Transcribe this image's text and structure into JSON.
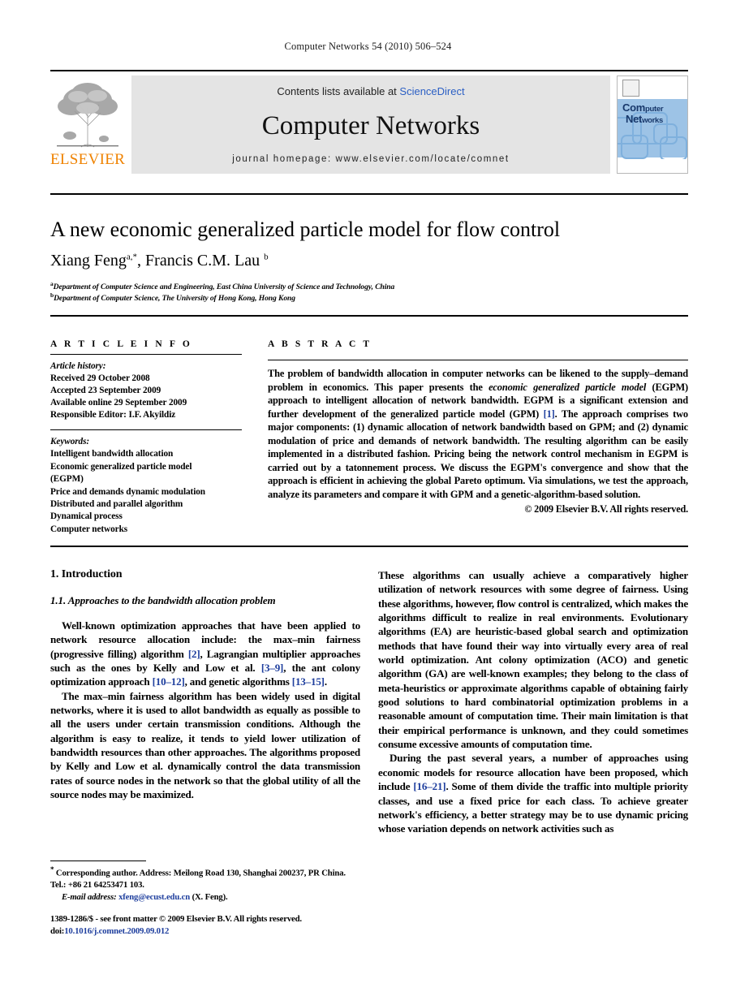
{
  "running_head": "Computer Networks 54 (2010) 506–524",
  "banner": {
    "contents_prefix": "Contents lists available at ",
    "contents_link": "ScienceDirect",
    "journal_title": "Computer Networks",
    "homepage": "journal homepage: www.elsevier.com/locate/comnet",
    "publisher_wordmark": "ELSEVIER",
    "cover": {
      "line1_strong": "Com",
      "line1_rest": "puter",
      "line2_strong": "Net",
      "line2_rest": "works"
    }
  },
  "article": {
    "title": "A new economic generalized particle model for flow control",
    "authors": "Xiang Feng",
    "author_sup_a": "a,*",
    "authors_second": ", Francis C.M. Lau ",
    "author_sup_b": "b",
    "affiliation_a_sup": "a",
    "affiliation_a": "Department of Computer Science and Engineering, East China University of Science and Technology, China",
    "affiliation_b_sup": "b",
    "affiliation_b": "Department of Computer Science, The University of Hong Kong, Hong Kong"
  },
  "info": {
    "heading": "A R T I C L E   I N F O",
    "history_label": "Article history:",
    "history": [
      "Received 29 October 2008",
      "Accepted 23 September 2009",
      "Available online 29 September 2009",
      "Responsible Editor: I.F. Akyildiz"
    ],
    "keywords_label": "Keywords:",
    "keywords": [
      "Intelligent bandwidth allocation",
      "Economic generalized particle model",
      "(EGPM)",
      "Price and demands dynamic modulation",
      "Distributed and parallel algorithm",
      "Dynamical process",
      "Computer networks"
    ]
  },
  "abstract": {
    "heading": "A B S T R A C T",
    "part1": "The problem of bandwidth allocation in computer networks can be likened to the supply–demand problem in economics. This paper presents the ",
    "italic1": "economic generalized particle model",
    "part2": " (EGPM) approach to intelligent allocation of network bandwidth. EGPM is a significant extension and further development of the generalized particle model (GPM) ",
    "cite1": "[1]",
    "part3": ". The approach comprises two major components: (1) dynamic allocation of network bandwidth based on GPM; and (2) dynamic modulation of price and demands of network bandwidth. The resulting algorithm can be easily implemented in a distributed fashion. Pricing being the network control mechanism in EGPM is carried out by a tatonnement process. We discuss the EGPM's convergence and show that the approach is efficient in achieving the global Pareto optimum. Via simulations, we test the approach, analyze its parameters and compare it with GPM and a genetic-algorithm-based solution.",
    "copyright": "© 2009 Elsevier B.V. All rights reserved."
  },
  "body": {
    "section_number_title": "1. Introduction",
    "subsection_number_title": "1.1. Approaches to the bandwidth allocation problem",
    "p1_a": "Well-known optimization approaches that have been applied to network resource allocation include: the max–min fairness (progressive filling) algorithm ",
    "p1_cite1": "[2]",
    "p1_b": ", Lagrangian multiplier approaches such as the ones by Kelly and Low et al. ",
    "p1_cite2": "[3–9]",
    "p1_c": ", the ant colony optimization approach ",
    "p1_cite3": "[10–12]",
    "p1_d": ", and genetic algorithms ",
    "p1_cite4": "[13–15]",
    "p1_e": ".",
    "p2": "The max–min fairness algorithm has been widely used in digital networks, where it is used to allot bandwidth as equally as possible to all the users under certain transmission conditions. Although the algorithm is easy to realize, it tends to yield lower utilization of bandwidth resources than other approaches. The algorithms proposed by Kelly and Low et al. dynamically control the data transmission rates of source nodes in the network so that the global utility of all the source nodes may be maximized.",
    "p3": "These algorithms can usually achieve a comparatively higher utilization of network resources with some degree of fairness. Using these algorithms, however, flow control is centralized, which makes the algorithms difficult to realize in real environments. Evolutionary algorithms (EA) are heuristic-based global search and optimization methods that have found their way into virtually every area of real world optimization. Ant colony optimization (ACO) and genetic algorithm (GA) are well-known examples; they belong to the class of meta-heuristics or approximate algorithms capable of obtaining fairly good solutions to hard combinatorial optimization problems in a reasonable amount of computation time. Their main limitation is that their empirical performance is unknown, and they could sometimes consume excessive amounts of computation time.",
    "p4_a": "During the past several years, a number of approaches using economic models for resource allocation have been proposed, which include ",
    "p4_cite1": "[16–21]",
    "p4_b": ". Some of them divide the traffic into multiple priority classes, and use a fixed price for each class. To achieve greater network's efficiency, a better strategy may be to use dynamic pricing whose variation depends on network activities such as"
  },
  "footnote": {
    "star": "*",
    "corresponding": " Corresponding author. Address: Meilong Road 130, Shanghai 200237, PR China. Tel.: +86 21 64253471 103.",
    "email_label": "E-mail address:",
    "email": "xfeng@ecust.edu.cn",
    "email_suffix": " (X. Feng).",
    "imprint_line1": "1389-1286/$ - see front matter © 2009 Elsevier B.V. All rights reserved.",
    "imprint_doi_label": "doi:",
    "imprint_doi": "10.1016/j.comnet.2009.09.012"
  },
  "colors": {
    "link_blue": "#2b5fc4",
    "cite_blue": "#1f3f9e",
    "elsevier_orange": "#ef8200",
    "cover_blue": "#9dc3e6",
    "banner_grey": "#e4e4e4"
  }
}
